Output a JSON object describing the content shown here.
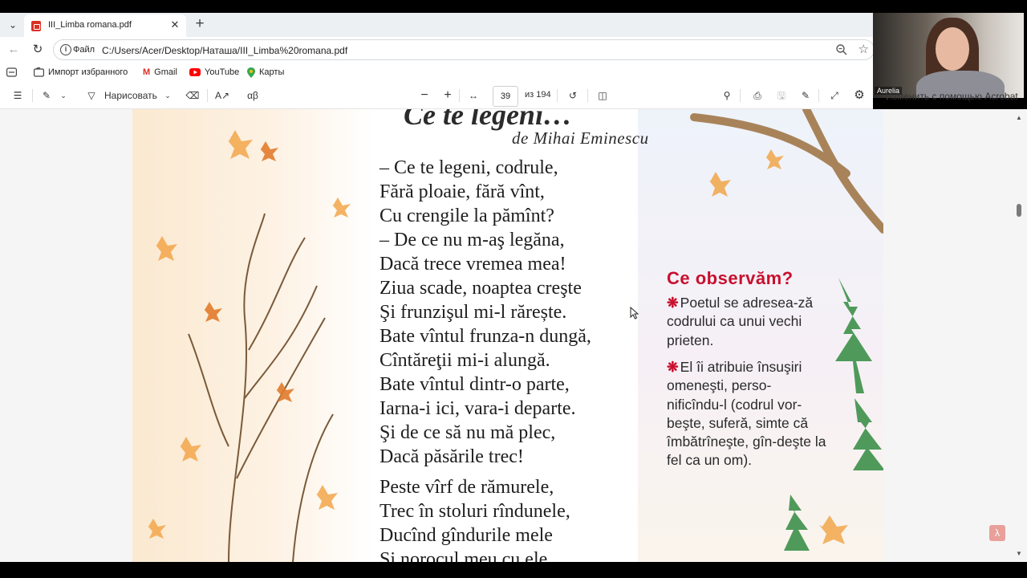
{
  "browser": {
    "tab_title": "III_Limba romana.pdf",
    "address_scheme": "Файл",
    "address_url": "C:/Users/Acer/Desktop/Наташа/III_Limba%20romana.pdf"
  },
  "favorites": {
    "import_label": "Импорт избранного",
    "items": [
      "Gmail",
      "YouTube",
      "Карты"
    ]
  },
  "pdf_toolbar": {
    "draw_label": "Нарисовать",
    "page_current": "39",
    "page_total": "из 194",
    "side_caption": "Изменить с помощью Acrobat"
  },
  "webcam": {
    "name": "Aurelia"
  },
  "document": {
    "title": "Ce te legeni…",
    "author": "de Mihai Eminescu",
    "stanza1": [
      "– Ce te legeni, codrule,",
      "Fără ploaie, fără vînt,",
      "Cu crengile la pămînt?",
      "– De ce nu m-aş legăna,",
      "Dacă trece vremea mea!",
      "Ziua scade, noaptea creşte",
      "Şi frunzişul mi-l rărește.",
      "Bate vîntul frunza-n dungă,",
      "Cîntăreţii mi-i alungă.",
      "Bate vîntul dintr-o parte,",
      "Iarna-i ici, vara-i departe.",
      "Şi de ce să nu mă plec,",
      "Dacă păsările trec!"
    ],
    "stanza2": [
      "Peste vîrf de rămurele,",
      "Trec în stoluri rîndunele,",
      "Ducînd gîndurile mele",
      "Şi norocul meu cu ele."
    ],
    "observations": {
      "title": "Ce observăm?",
      "items": [
        "Poetul se adresea-ză codrului ca unui vechi prieten.",
        "El îi atribuie însuşiri omeneşti, perso-nificîndu-l (codrul vor-beşte, suferă, simte că îmbătrîneşte, gîn-deşte la fel ca un om)."
      ]
    }
  },
  "colors": {
    "accent_red": "#c8102e",
    "text_dark": "#1e1e1e"
  }
}
